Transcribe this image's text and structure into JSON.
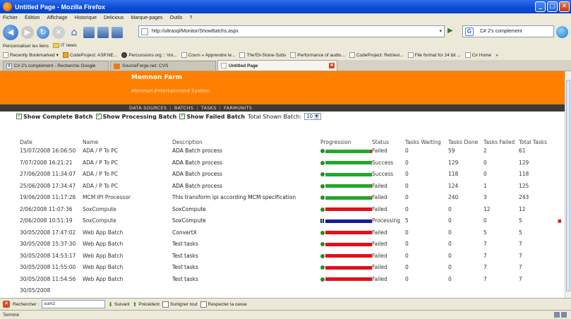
{
  "window": {
    "title": "Untitled Page - Mozilla Firefox"
  },
  "menubar": [
    "Fichier",
    "Édition",
    "Affichage",
    "Historique",
    "Delicious",
    "Marque-pages",
    "Outils",
    "?"
  ],
  "nav": {
    "url": "http://ultrasql/Monitor/ShowBatchs.aspx",
    "search_value": "C# 2's complement"
  },
  "personal_bar": [
    "Personnaliser les liens",
    "IT news"
  ],
  "bookmarks": [
    "Recently Bookmarked",
    "CodeProject: ASP.NE...",
    "Percussions.org :: Voi...",
    "Cours « Apprendre le...",
    "The'Eli-Stone-Subs",
    "Performance of audio...",
    "CodeProject: Retrievi...",
    "File format for 24 bit ...",
    "C# Home",
    "»"
  ],
  "tabs": [
    "C# 2's complement - Recherche Google",
    "SourceForge.net: CVS",
    "Untitled Page"
  ],
  "banner": {
    "company": "Memnon Farm",
    "tagline": "Memnon Entertainment System"
  },
  "site_menu": [
    "DATA SOURCES",
    "BATCHS",
    "TASKS",
    "FARMUNITS"
  ],
  "filters": {
    "show_complete": "Show Complete Batch",
    "show_processing": "Show Processing Batch",
    "show_failed": "Show Failed Batch",
    "total_label": "Total Shown Batch:",
    "total_value": "10"
  },
  "table": {
    "headers": {
      "date": "Date",
      "name": "Name",
      "description": "Description",
      "progression": "Progression",
      "status": "Status",
      "tasks_waiting": "Tasks Waiting",
      "tasks_done": "Tasks Done",
      "tasks_failed": "Tasks Failed",
      "total_tasks": "Total Tasks"
    },
    "rows": [
      {
        "date": "15/07/2008 16:06:50",
        "name": "ADA / P To PC",
        "description": "ADA Batch process",
        "progress": 0.97,
        "bar": "green",
        "icon": "green",
        "status": "Failed",
        "waiting": "0",
        "done": "59",
        "failed": "2",
        "total": "61"
      },
      {
        "date": "7/07/2008 16:21:21",
        "name": "ADA / P To PC",
        "description": "ADA Batch process",
        "progress": 1.0,
        "bar": "green",
        "icon": "green",
        "status": "Success",
        "waiting": "0",
        "done": "129",
        "failed": "0",
        "total": "129"
      },
      {
        "date": "27/06/2008 11:34:07",
        "name": "ADA / P To PC",
        "description": "ADA Batch process",
        "progress": 1.0,
        "bar": "green",
        "icon": "green",
        "status": "Success",
        "waiting": "0",
        "done": "118",
        "failed": "0",
        "total": "118"
      },
      {
        "date": "25/06/2008 17:34:47",
        "name": "ADA / P To PC",
        "description": "ADA Batch process",
        "progress": 0.99,
        "bar": "green",
        "icon": "green",
        "status": "Failed",
        "waiting": "0",
        "done": "124",
        "failed": "1",
        "total": "125"
      },
      {
        "date": "19/06/2008 11:17:26",
        "name": "MCM IPI Processor",
        "description": "This transform ipi according MCM specification",
        "progress": 0.99,
        "bar": "green",
        "icon": "green",
        "status": "Failed",
        "waiting": "0",
        "done": "240",
        "failed": "3",
        "total": "243"
      },
      {
        "date": "2/06/2008 11:07:36",
        "name": "SoxCompute",
        "description": "SoxCompute",
        "progress": 0.0,
        "bar": "green",
        "icon": "green",
        "status": "Failed",
        "waiting": "0",
        "done": "0",
        "failed": "12",
        "total": "12"
      },
      {
        "date": "2/06/2008 10:51:19",
        "name": "SoxCompute",
        "description": "SoxCompute",
        "progress": 1.0,
        "bar": "blue",
        "icon": "pause",
        "status": "Processing",
        "waiting": "5",
        "done": "0",
        "failed": "0",
        "total": "5",
        "deletable": true
      },
      {
        "date": "30/05/2008 17:47:02",
        "name": "Web App Batch",
        "description": "ConvertX",
        "progress": 0.0,
        "bar": "green",
        "icon": "green",
        "status": "Failed",
        "waiting": "0",
        "done": "0",
        "failed": "5",
        "total": "5"
      },
      {
        "date": "30/05/2008 15:37:30",
        "name": "Web App Batch",
        "description": "Test tasks",
        "progress": 0.0,
        "bar": "green",
        "icon": "green",
        "status": "Failed",
        "waiting": "0",
        "done": "0",
        "failed": "7",
        "total": "7"
      },
      {
        "date": "30/05/2008 14:53:17",
        "name": "Web App Batch",
        "description": "Test tasks",
        "progress": 0.0,
        "bar": "green",
        "icon": "green",
        "status": "Failed",
        "waiting": "0",
        "done": "0",
        "failed": "7",
        "total": "7"
      },
      {
        "date": "30/05/2008 11:55:00",
        "name": "Web App Batch",
        "description": "Test tasks",
        "progress": 0.0,
        "bar": "green",
        "icon": "green",
        "status": "Failed",
        "waiting": "0",
        "done": "0",
        "failed": "7",
        "total": "7"
      },
      {
        "date": "30/05/2008 11:54:56",
        "name": "Web App Batch",
        "description": "Test tasks",
        "progress": 0.0,
        "bar": "green",
        "icon": "green",
        "status": "Failed",
        "waiting": "0",
        "done": "0",
        "failed": "7",
        "total": "7"
      },
      {
        "date": "30/05/2008",
        "name": "",
        "description": "",
        "progress": null,
        "bar": "",
        "icon": "",
        "status": "",
        "waiting": "",
        "done": "",
        "failed": "",
        "total": ""
      }
    ]
  },
  "findbar": {
    "label": "Rechercher :",
    "value": "sum2",
    "next": "Suivant",
    "prev": "Précédent",
    "highlight": "Surligner tout",
    "match_case": "Respecter la casse"
  },
  "status": {
    "text": "Terminé"
  },
  "colors": {
    "banner": "#ff7f00",
    "progress_ok": "#21a82b",
    "progress_bad": "#e0101a",
    "progress_processing": "#1a1a9a"
  }
}
